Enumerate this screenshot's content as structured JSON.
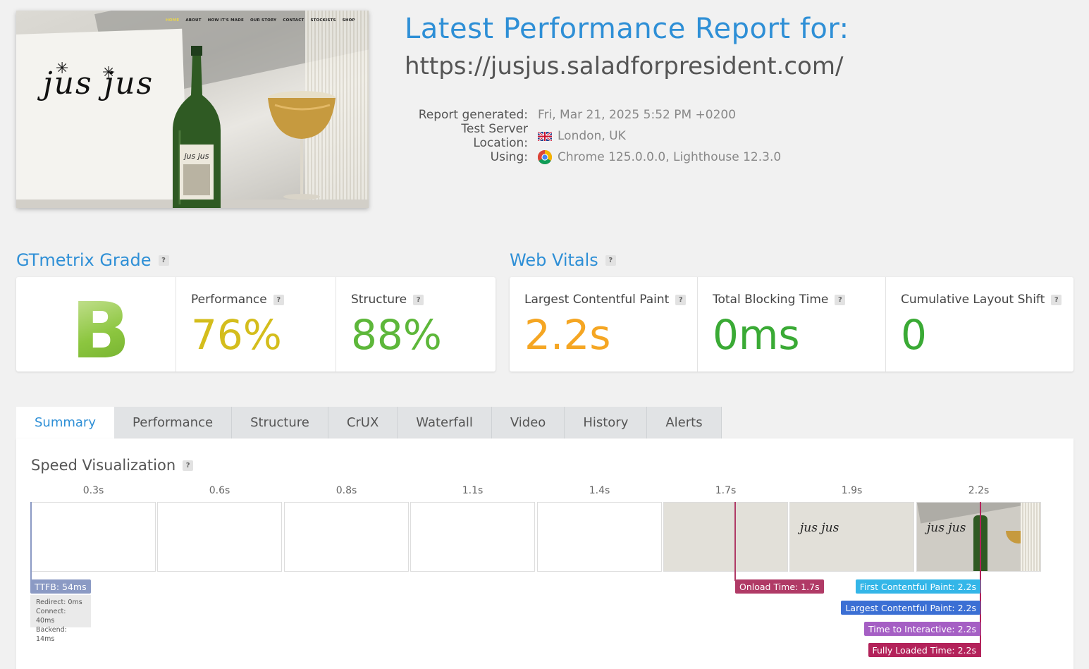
{
  "screenshot": {
    "nav": [
      "HOME",
      "ABOUT",
      "HOW IT'S MADE",
      "OUR STORY",
      "CONTACT",
      "STOCKISTS",
      "SHOP"
    ],
    "logo_text": "jus jus"
  },
  "header": {
    "title": "Latest Performance Report for:",
    "url": "https://jusjus.saladforpresident.com/"
  },
  "meta": {
    "generated_label": "Report generated:",
    "generated_value": "Fri, Mar 21, 2025 5:52 PM +0200",
    "location_label": "Test Server Location:",
    "location_value": "London, UK",
    "using_label": "Using:",
    "using_value": "Chrome 125.0.0.0, Lighthouse 12.3.0"
  },
  "grade": {
    "title": "GTmetrix Grade",
    "help": "?",
    "letter": "B",
    "performance_label": "Performance",
    "performance_value": "76%",
    "structure_label": "Structure",
    "structure_value": "88%"
  },
  "vitals": {
    "title": "Web Vitals",
    "help": "?",
    "lcp_label": "Largest Contentful Paint",
    "lcp_value": "2.2s",
    "tbt_label": "Total Blocking Time",
    "tbt_value": "0ms",
    "cls_label": "Cumulative Layout Shift",
    "cls_value": "0"
  },
  "tabs": [
    "Summary",
    "Performance",
    "Structure",
    "CrUX",
    "Waterfall",
    "Video",
    "History",
    "Alerts"
  ],
  "speed": {
    "title": "Speed Visualization",
    "help": "?",
    "frames": [
      "0.3s",
      "0.6s",
      "0.8s",
      "1.1s",
      "1.4s",
      "1.7s",
      "1.9s",
      "2.2s"
    ],
    "ttfb": "TTFB: 54ms",
    "ttfb_redirect": "Redirect: 0ms",
    "ttfb_connect": "Connect: 40ms",
    "ttfb_backend": "Backend: 14ms",
    "onload": "Onload Time: 1.7s",
    "fcp": "First Contentful Paint: 2.2s",
    "lcp": "Largest Contentful Paint: 2.2s",
    "tti": "Time to Interactive: 2.2s",
    "fully_loaded": "Fully Loaded Time: 2.2s"
  },
  "colors": {
    "accent": "#2e8fd6",
    "performance": "#d4bd1c",
    "structure": "#5db73a",
    "lcp": "#f5a623",
    "good": "#3aaa35",
    "ttfb_marker": "#8b9ac4",
    "onload_marker": "#b03a66",
    "fcp_marker": "#34b6e8",
    "lcp_marker": "#3b6fd4",
    "tti_marker": "#a55fc4",
    "fully_marker": "#b3225a"
  }
}
